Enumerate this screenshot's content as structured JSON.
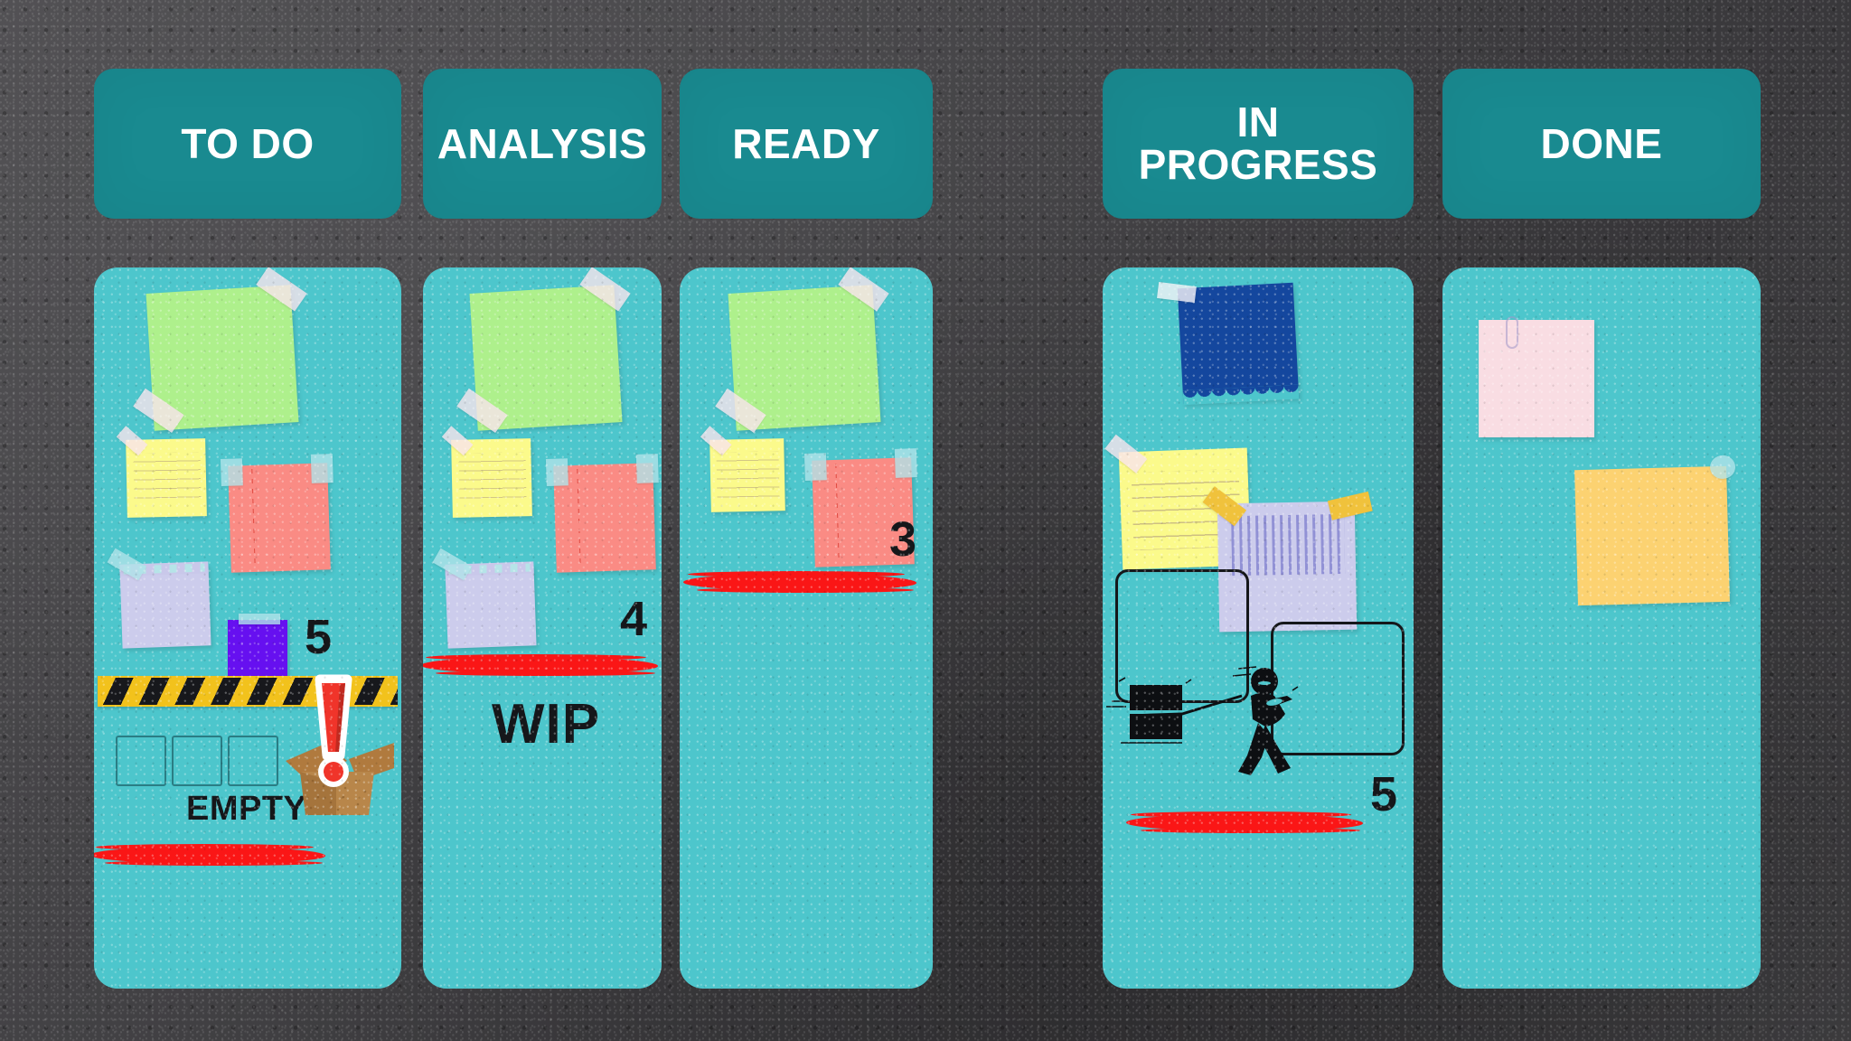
{
  "board": {
    "background_color": "#454447",
    "header_color": "#198a90",
    "body_color": "#4dc6cc",
    "accent_red": "#fa1616",
    "marker_black": "#15171a",
    "tape_yellow": "#f2c21c"
  },
  "columns": [
    {
      "id": "todo",
      "title": "TO DO",
      "wip_limit": "5",
      "status_label": "EMPTY",
      "notes": [
        {
          "name": "green-note",
          "color": "#aef08c"
        },
        {
          "name": "yellow-note",
          "color": "#fbfa8b"
        },
        {
          "name": "salmon-note",
          "color": "#fa8b84"
        },
        {
          "name": "lavender-note",
          "color": "#ccccec"
        },
        {
          "name": "purple-note",
          "color": "#6610f0"
        }
      ],
      "placeholders": 3,
      "has_barrier_tape": true,
      "has_alert_box": true,
      "has_redline": true
    },
    {
      "id": "analysis",
      "title": "ANALYSIS",
      "wip_limit": "4",
      "status_label": "WIP",
      "notes": [
        {
          "name": "green-note",
          "color": "#aef08c"
        },
        {
          "name": "yellow-note",
          "color": "#fbfa8b"
        },
        {
          "name": "salmon-note",
          "color": "#fa8b84"
        },
        {
          "name": "lavender-note",
          "color": "#ccccec"
        }
      ],
      "placeholders": 0,
      "has_barrier_tape": false,
      "has_alert_box": false,
      "has_redline": true
    },
    {
      "id": "ready",
      "title": "READY",
      "wip_limit": "3",
      "status_label": "",
      "notes": [
        {
          "name": "green-note",
          "color": "#aef08c"
        },
        {
          "name": "yellow-note",
          "color": "#fbfa8b"
        },
        {
          "name": "salmon-note",
          "color": "#fa8b84"
        }
      ],
      "placeholders": 0,
      "has_barrier_tape": false,
      "has_alert_box": false,
      "has_redline": true
    },
    {
      "id": "in-progress",
      "title": "IN\nPROGRESS",
      "wip_limit": "5",
      "status_label": "",
      "notes": [
        {
          "name": "dark-blue-note",
          "color": "#14479e"
        },
        {
          "name": "yellow-note",
          "color": "#fbfa8b"
        },
        {
          "name": "lavender-note",
          "color": "#ccccec"
        }
      ],
      "placeholders": 2,
      "has_barrier_tape": false,
      "has_alert_box": false,
      "has_redline": true,
      "has_worker_figure": true
    },
    {
      "id": "done",
      "title": "DONE",
      "wip_limit": "",
      "status_label": "",
      "notes": [
        {
          "name": "pink-note",
          "color": "#f9dde3"
        },
        {
          "name": "orange-note",
          "color": "#fcd271"
        }
      ],
      "placeholders": 0,
      "has_barrier_tape": false,
      "has_alert_box": false,
      "has_redline": false
    }
  ]
}
